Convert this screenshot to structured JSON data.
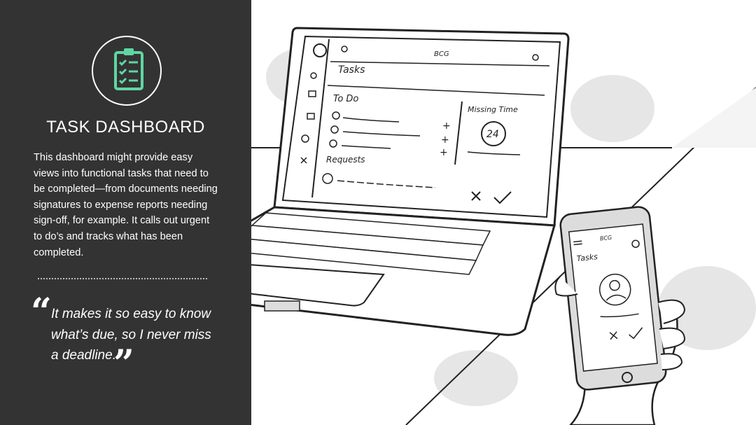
{
  "panel": {
    "title": "TASK DASHBOARD",
    "description": "This dashboard might provide easy views into functional tasks that need to be completed—from documents needing signatures to expense reports needing sign-off, for example. It calls out urgent to do’s and tracks what has been completed.",
    "quote": "It makes it so easy to know what’s due, so I never miss a deadline.",
    "icon": "clipboard-checklist-icon",
    "accent_color": "#5fd6a2",
    "background_color": "#333333"
  },
  "laptop_screen": {
    "brand": "BCG",
    "section_title": "Tasks",
    "todo_heading": "To Do",
    "missing_time_heading": "Missing Time",
    "missing_time_value": "24",
    "requests_heading": "Requests"
  },
  "phone_screen": {
    "brand": "BCG",
    "title": "Tasks"
  }
}
